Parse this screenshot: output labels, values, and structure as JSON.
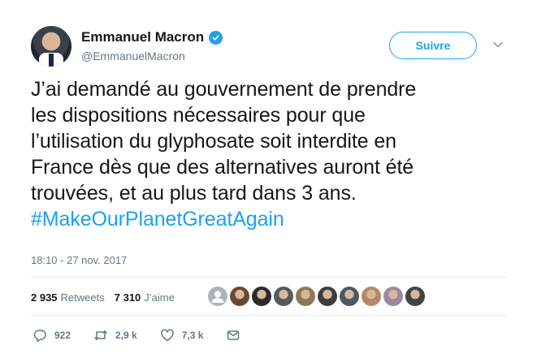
{
  "tweet": {
    "author_name": "Emmanuel Macron",
    "author_handle": "@EmmanuelMacron",
    "follow_label": "Suivre",
    "text_lines": [
      "J’ai demandé au gouvernement de prendre",
      "les dispositions nécessaires pour que",
      "l’utilisation du glyphosate soit interdite en",
      "France dès que des alternatives auront été",
      "trouvées, et au plus tard dans 3 ans."
    ],
    "hashtag": "#MakeOurPlanetGreatAgain",
    "timestamp": "18:10 - 27 nov. 2017"
  },
  "stats": {
    "retweets_count": "2 935",
    "retweets_label": "Retweets",
    "likes_count": "7 310",
    "likes_label": "J’aime"
  },
  "liker_faces": [
    {
      "color": "#a9b4be",
      "icon": "default-avatar"
    },
    {
      "color": "#6b4a35"
    },
    {
      "color": "#2b2b2b"
    },
    {
      "color": "#555a5f"
    },
    {
      "color": "#8a7a58"
    },
    {
      "color": "#3e3e3e"
    },
    {
      "color": "#4a5a6a"
    },
    {
      "color": "#b08a6a"
    },
    {
      "color": "#9a8aa0"
    },
    {
      "color": "#444444"
    }
  ],
  "actions": {
    "replies": "922",
    "retweets": "2,9 k",
    "likes": "7,3 k"
  },
  "colors": {
    "accent": "#1da1f2",
    "text": "#14171a",
    "muted": "#657786",
    "divider": "#e6ecf0"
  }
}
